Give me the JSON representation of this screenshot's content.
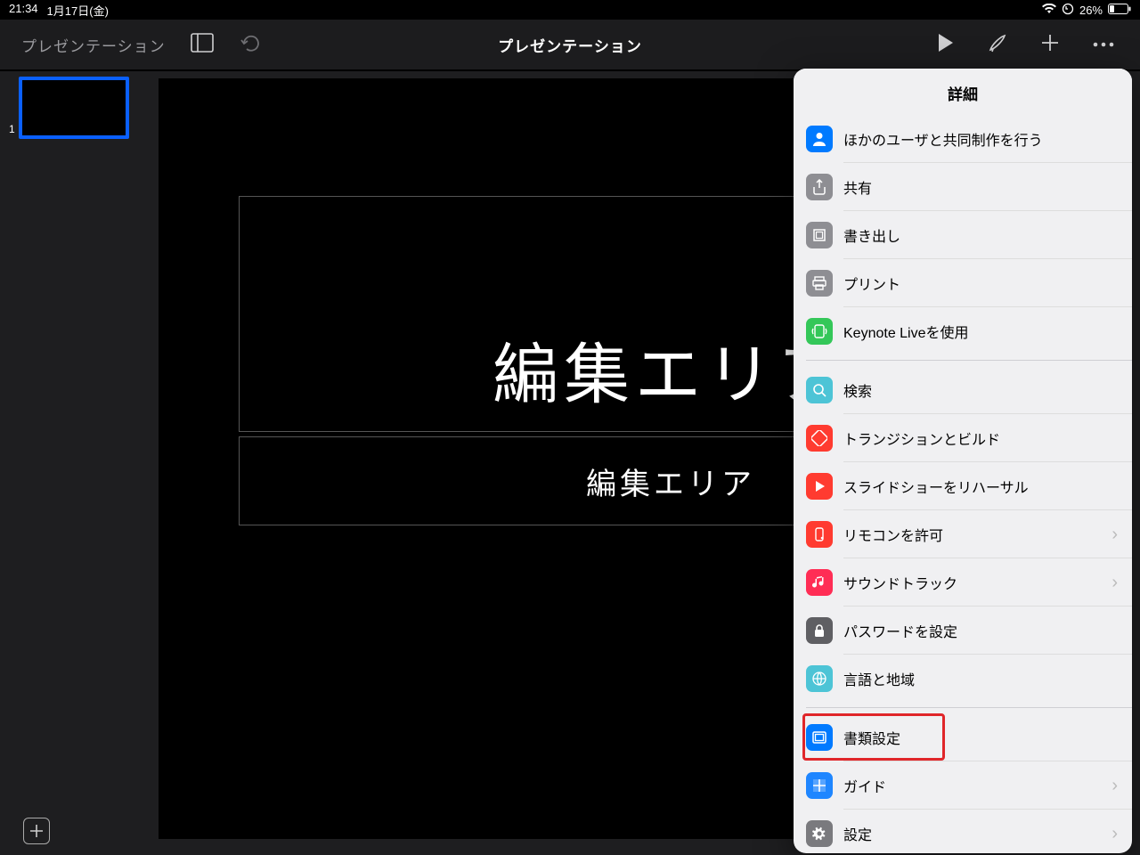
{
  "status": {
    "time": "21:34",
    "date": "1月17日(金)",
    "battery": "26%"
  },
  "toolbar": {
    "back": "プレゼンテーション",
    "title": "プレゼンテーション"
  },
  "nav": {
    "thumb_index": "1"
  },
  "canvas": {
    "title_text": "編集エリア",
    "subtitle_text": "編集エリア"
  },
  "popover": {
    "title": "詳細",
    "items": [
      {
        "label": "ほかのユーザと共同制作を行う",
        "icon": "person-icon",
        "bg": "bg-blue",
        "chev": false
      },
      {
        "label": "共有",
        "icon": "share-icon",
        "bg": "bg-gray",
        "chev": false
      },
      {
        "label": "書き出し",
        "icon": "export-icon",
        "bg": "bg-gray",
        "chev": false
      },
      {
        "label": "プリント",
        "icon": "print-icon",
        "bg": "bg-gray",
        "chev": false
      },
      {
        "label": "Keynote Liveを使用",
        "icon": "live-icon",
        "bg": "bg-green",
        "chev": false
      },
      {
        "label": "検索",
        "icon": "search-icon",
        "bg": "bg-teal",
        "chev": false
      },
      {
        "label": "トランジションとビルド",
        "icon": "transition-icon",
        "bg": "bg-red",
        "chev": false
      },
      {
        "label": "スライドショーをリハーサル",
        "icon": "rehearse-icon",
        "bg": "bg-red",
        "chev": false
      },
      {
        "label": "リモコンを許可",
        "icon": "remote-icon",
        "bg": "bg-red",
        "chev": true
      },
      {
        "label": "サウンドトラック",
        "icon": "music-icon",
        "bg": "bg-red2",
        "chev": true
      },
      {
        "label": "パスワードを設定",
        "icon": "lock-icon",
        "bg": "bg-slate",
        "chev": false
      },
      {
        "label": "言語と地域",
        "icon": "globe-icon",
        "bg": "bg-teal",
        "chev": false
      },
      {
        "label": "書類設定",
        "icon": "docsetup-icon",
        "bg": "bg-blue2",
        "chev": false,
        "highlight": true
      },
      {
        "label": "ガイド",
        "icon": "guide-icon",
        "bg": "bg-blue3",
        "chev": true
      },
      {
        "label": "設定",
        "icon": "settings-icon",
        "bg": "bg-grayd",
        "chev": true
      }
    ],
    "section_breaks_after": [
      4,
      11
    ]
  }
}
